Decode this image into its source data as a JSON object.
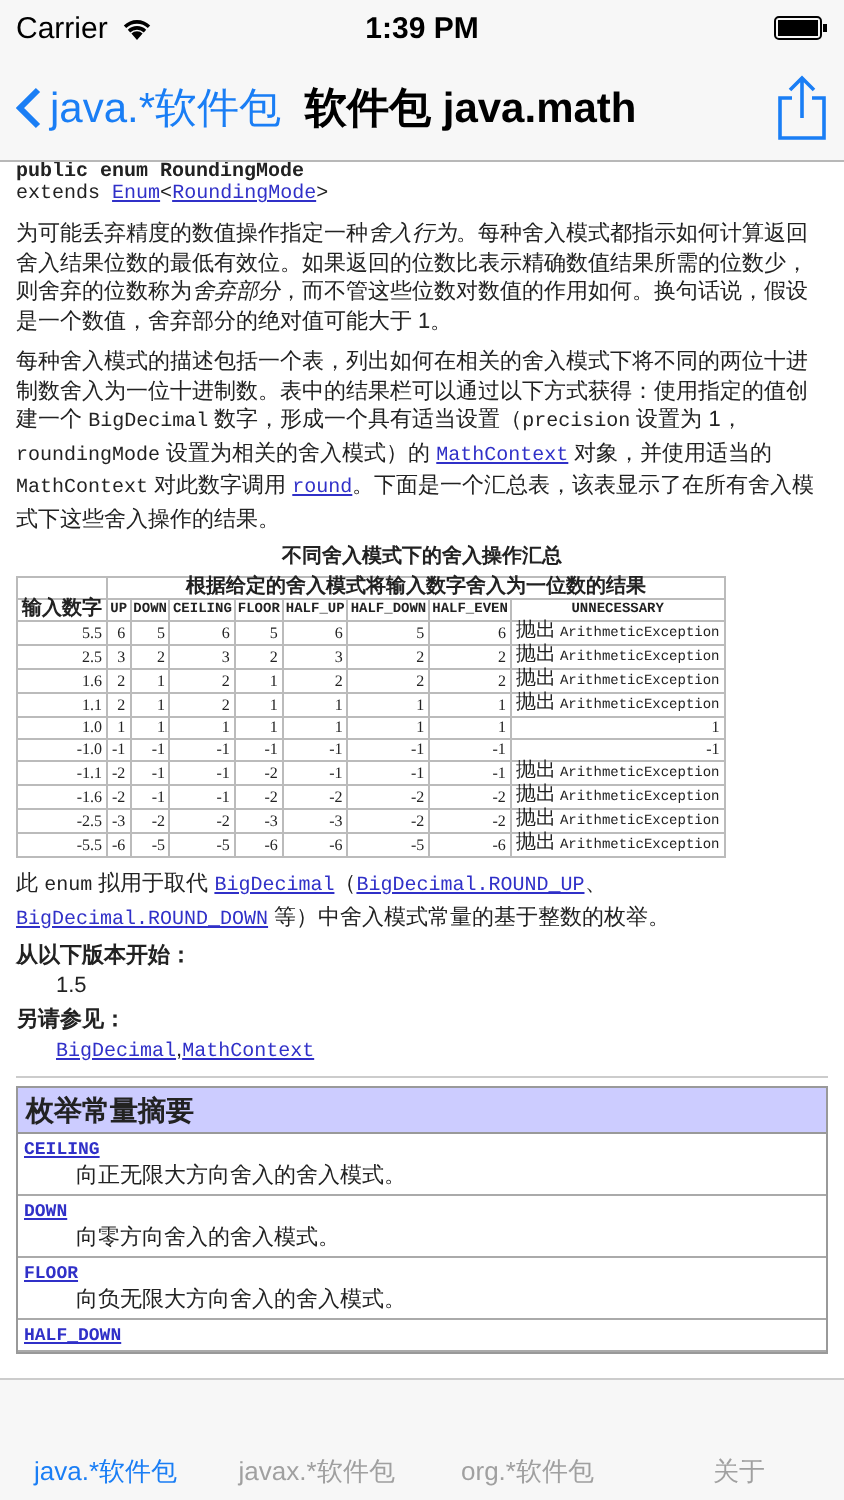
{
  "status_bar": {
    "carrier": "Carrier",
    "time": "1:39 PM"
  },
  "nav": {
    "back": "java.*软件包",
    "title": "软件包 java.math"
  },
  "declaration": {
    "line1": "public enum RoundingMode",
    "extends_keyword": "extends",
    "enum_link": "Enum",
    "type_open": "<",
    "type_link": "RoundingMode",
    "type_close": ">"
  },
  "paragraph_1": [
    {
      "kind": "text",
      "text": "为可能丢弃精度的数值操作指定一种"
    },
    {
      "kind": "italic",
      "text": "舍入行为"
    },
    {
      "kind": "text",
      "text": "。每种舍入模式都指示如何计算返回舍入结果位数的最低有效位。如果返回的位数比表示精确数值结果所需的位数少，则舍弃的位数称为"
    },
    {
      "kind": "italic",
      "text": "舍弃部分"
    },
    {
      "kind": "text",
      "text": "，而不管这些位数对数值的作用如何。换句话说，假设是一个数值，舍弃部分的绝对值可能大于 1。"
    }
  ],
  "paragraph_2": [
    {
      "kind": "text",
      "text": "每种舍入模式的描述包括一个表，列出如何在相关的舍入模式下将不同的两位十进制数舍入为一位十进制数。表中的结果栏可以通过以下方式获得：使用指定的值创建一个 "
    },
    {
      "kind": "code",
      "text": "BigDecimal"
    },
    {
      "kind": "text",
      "text": " 数字，形成一个具有适当设置（"
    },
    {
      "kind": "code",
      "text": "precision"
    },
    {
      "kind": "text",
      "text": " 设置为 1，"
    },
    {
      "kind": "code",
      "text": "roundingMode"
    },
    {
      "kind": "text",
      "text": " 设置为相关的舍入模式）的 "
    },
    {
      "kind": "link",
      "text": "MathContext"
    },
    {
      "kind": "text",
      "text": " 对象，并使用适当的 "
    },
    {
      "kind": "code",
      "text": "MathContext"
    },
    {
      "kind": "text",
      "text": " 对此数字调用 "
    },
    {
      "kind": "link",
      "text": "round"
    },
    {
      "kind": "text",
      "text": "。下面是一个汇总表，该表显示了在所有舍入模式下这些舍入操作的结果。"
    }
  ],
  "table": {
    "caption": "不同舍入模式下的舍入操作汇总",
    "group_header": "根据给定的舍入模式将输入数字舍入为一位数的结果",
    "columns": [
      "输入数字",
      "UP",
      "DOWN",
      "CEILING",
      "FLOOR",
      "HALF_UP",
      "HALF_DOWN",
      "HALF_EVEN",
      "UNNECESSARY"
    ],
    "rows": [
      {
        "cells": [
          "5.5",
          "6",
          "5",
          "6",
          "5",
          "6",
          "5",
          "6"
        ],
        "result": {
          "kind": "exception",
          "label": "抛出",
          "code": "ArithmeticException"
        }
      },
      {
        "cells": [
          "2.5",
          "3",
          "2",
          "3",
          "2",
          "3",
          "2",
          "2"
        ],
        "result": {
          "kind": "exception",
          "label": "抛出",
          "code": "ArithmeticException"
        }
      },
      {
        "cells": [
          "1.6",
          "2",
          "1",
          "2",
          "1",
          "2",
          "2",
          "2"
        ],
        "result": {
          "kind": "exception",
          "label": "抛出",
          "code": "ArithmeticException"
        }
      },
      {
        "cells": [
          "1.1",
          "2",
          "1",
          "2",
          "1",
          "1",
          "1",
          "1"
        ],
        "result": {
          "kind": "exception",
          "label": "抛出",
          "code": "ArithmeticException"
        }
      },
      {
        "cells": [
          "1.0",
          "1",
          "1",
          "1",
          "1",
          "1",
          "1",
          "1"
        ],
        "result": {
          "kind": "value",
          "text": "1"
        }
      },
      {
        "cells": [
          "-1.0",
          "-1",
          "-1",
          "-1",
          "-1",
          "-1",
          "-1",
          "-1"
        ],
        "result": {
          "kind": "value",
          "text": "-1"
        }
      },
      {
        "cells": [
          "-1.1",
          "-2",
          "-1",
          "-1",
          "-2",
          "-1",
          "-1",
          "-1"
        ],
        "result": {
          "kind": "exception",
          "label": "抛出",
          "code": "ArithmeticException"
        }
      },
      {
        "cells": [
          "-1.6",
          "-2",
          "-1",
          "-1",
          "-2",
          "-2",
          "-2",
          "-2"
        ],
        "result": {
          "kind": "exception",
          "label": "抛出",
          "code": "ArithmeticException"
        }
      },
      {
        "cells": [
          "-2.5",
          "-3",
          "-2",
          "-2",
          "-3",
          "-3",
          "-2",
          "-2"
        ],
        "result": {
          "kind": "exception",
          "label": "抛出",
          "code": "ArithmeticException"
        }
      },
      {
        "cells": [
          "-5.5",
          "-6",
          "-5",
          "-5",
          "-6",
          "-6",
          "-5",
          "-6"
        ],
        "result": {
          "kind": "exception",
          "label": "抛出",
          "code": "ArithmeticException"
        }
      }
    ]
  },
  "paragraph_3": [
    {
      "kind": "text",
      "text": "此 "
    },
    {
      "kind": "code",
      "text": "enum"
    },
    {
      "kind": "text",
      "text": " 拟用于取代 "
    },
    {
      "kind": "link",
      "text": "BigDecimal"
    },
    {
      "kind": "text",
      "text": "（"
    },
    {
      "kind": "link",
      "text": "BigDecimal.ROUND_UP"
    },
    {
      "kind": "text",
      "text": "、"
    },
    {
      "kind": "link",
      "text": "BigDecimal.ROUND_DOWN"
    },
    {
      "kind": "text",
      "text": " 等）中舍入模式常量的基于整数的枚举。"
    }
  ],
  "since": {
    "label": "从以下版本开始：",
    "value": "1.5"
  },
  "see_also": {
    "label": "另请参见：",
    "links": [
      "BigDecimal",
      "MathContext"
    ],
    "separator": ","
  },
  "summary": {
    "heading": "枚举常量摘要",
    "rows": [
      {
        "name": "CEILING",
        "description": "向正无限大方向舍入的舍入模式。"
      },
      {
        "name": "DOWN",
        "description": "向零方向舍入的舍入模式。"
      },
      {
        "name": "FLOOR",
        "description": "向负无限大方向舍入的舍入模式。"
      },
      {
        "name": "HALF_DOWN"
      }
    ]
  },
  "tabs": [
    {
      "label": "java.*软件包",
      "selected": true
    },
    {
      "label": "javax.*软件包",
      "selected": false
    },
    {
      "label": "org.*软件包",
      "selected": false
    },
    {
      "label": "关于",
      "selected": false
    }
  ]
}
